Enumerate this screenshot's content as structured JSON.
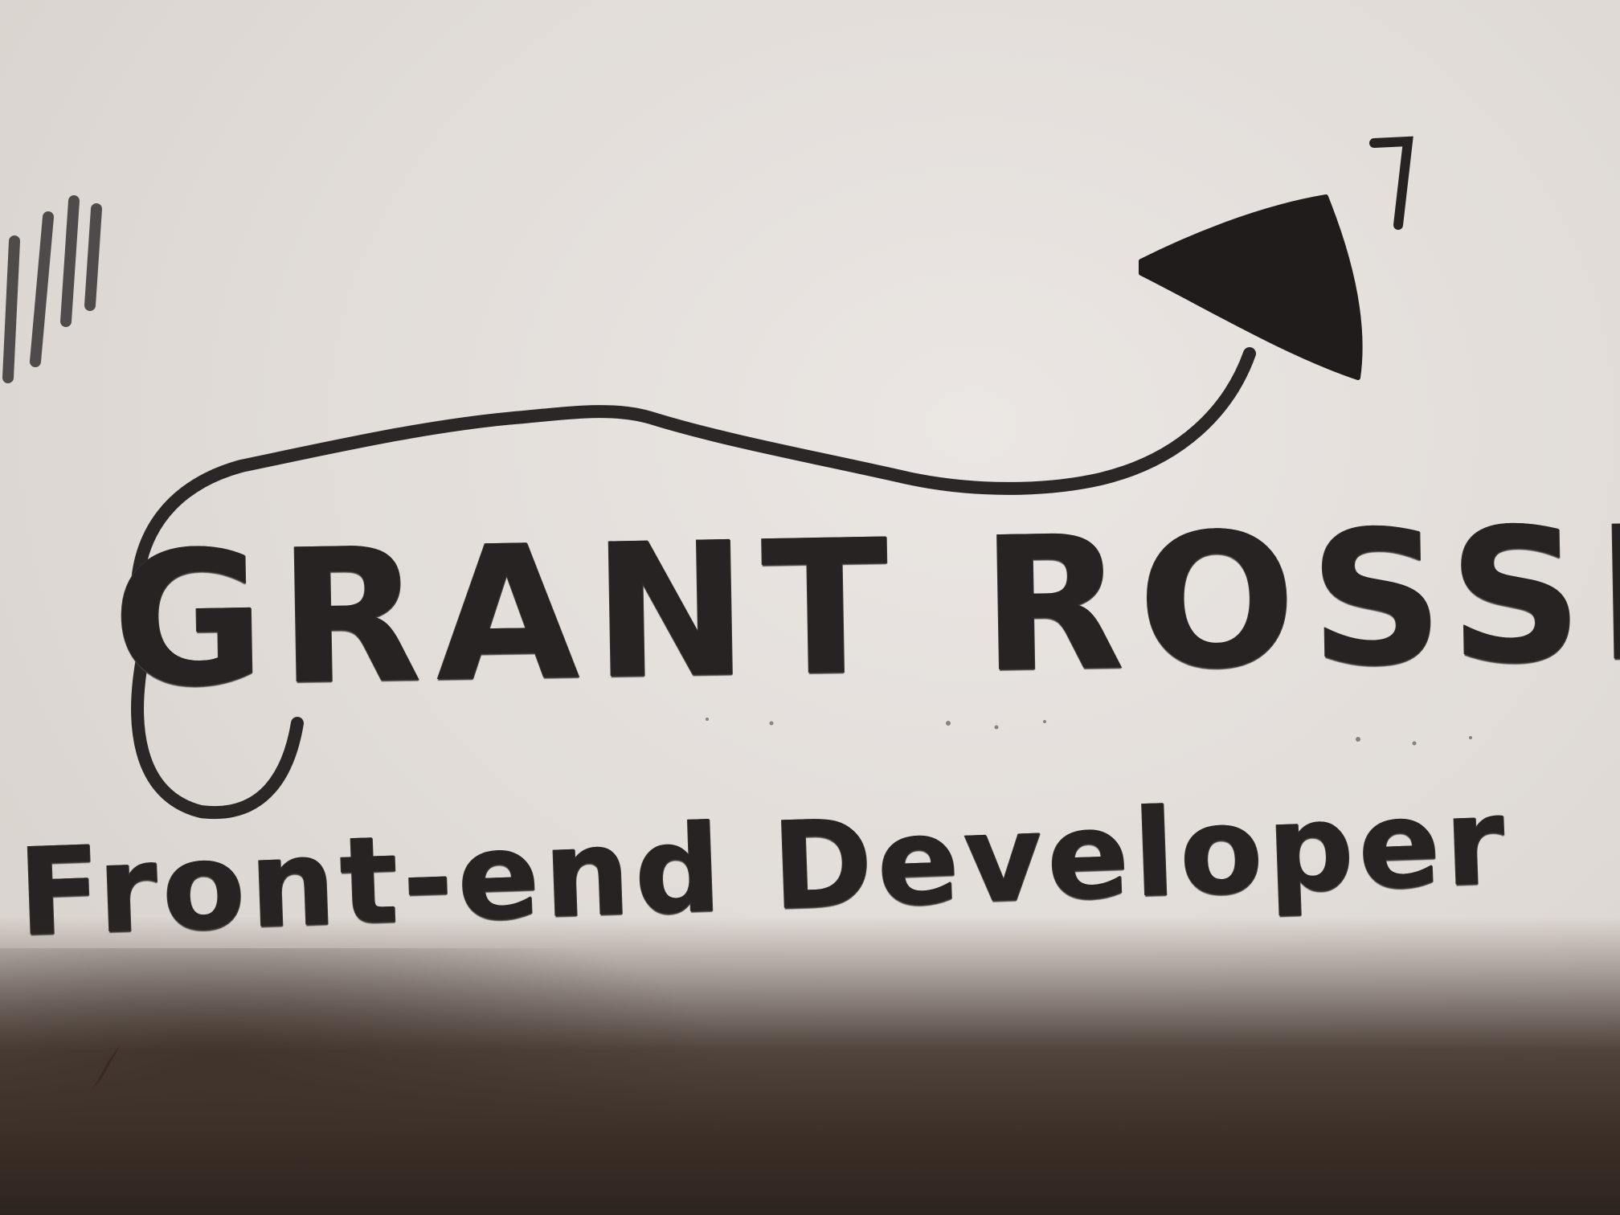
{
  "logo_sketch": {
    "name": "GRANT ROSSI",
    "tagline": "Front-end Developer"
  },
  "colors": {
    "ink": "#262322",
    "paper": "#e4dfdb",
    "shadow": "#3b2e27"
  }
}
